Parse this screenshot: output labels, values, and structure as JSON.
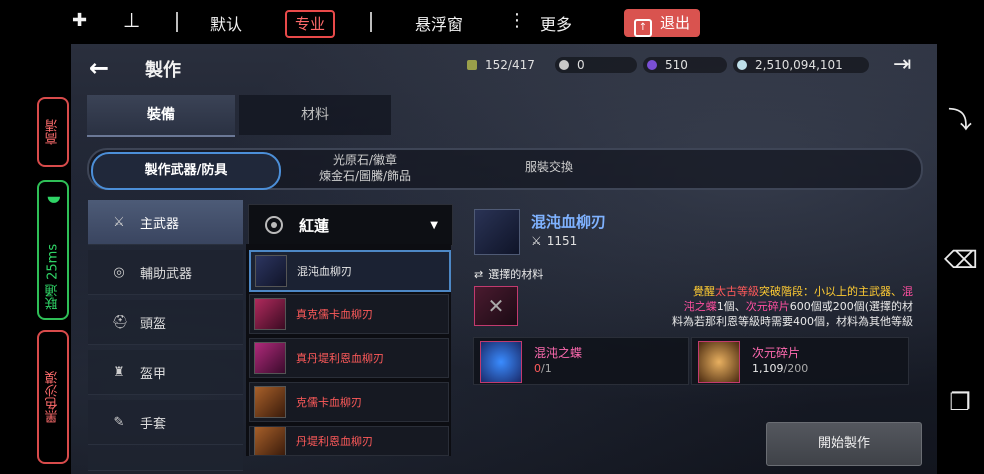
{
  "topbar": {
    "btn1_icon": "joystick-icon",
    "btn2_icon": "joystick-alt-icon",
    "default_label": "默认",
    "pro_label": "专业",
    "keyboard_label": "悬浮窗",
    "more_label": "更多",
    "exit_label": "退出",
    "accent": "#d9534f"
  },
  "side": {
    "hd_label": "高清",
    "network_label": "联通 25ms",
    "game_label": "黑色沙漠",
    "good_color": "#2fbf57"
  },
  "game": {
    "title": "製作",
    "resources": {
      "weight": "152/417",
      "silver": "0",
      "pearl": "510",
      "coin": "2,510,094,101"
    },
    "main_tabs": [
      "裝備",
      "材料"
    ],
    "sub_tabs": [
      "製作武器/防具",
      "光原石/徽章",
      "煉金石/圖騰/飾品",
      "服裝交換"
    ],
    "categories": [
      "主武器",
      "輔助武器",
      "頭盔",
      "盔甲",
      "手套"
    ],
    "dropdown_value": "紅蓮",
    "items": [
      {
        "name": "混沌血柳刃",
        "color": "#e8e8e8"
      },
      {
        "name": "真克儒卡血柳刃",
        "color": "#ff5a5a"
      },
      {
        "name": "真丹堤利恩血柳刃",
        "color": "#ff5a5a"
      },
      {
        "name": "克儒卡血柳刃",
        "color": "#ff5a5a"
      },
      {
        "name": "丹堤利恩血柳刃",
        "color": "#ff5a5a"
      }
    ],
    "detail": {
      "name": "混沌血柳刃",
      "count": "1151",
      "selected_materials_label": "選擇的材料",
      "desc_line1_prefix": "覺醒",
      "desc_line1_mid": "太古等級",
      "desc_line1_b": "突破階段",
      "desc_line1_c": "：小以上的主武器、",
      "desc_line1_d": "混",
      "desc_line2_a": "沌之蝶",
      "desc_line2_b": "1個、",
      "desc_line2_c": "次元碎片",
      "desc_line2_d": "600個或200個(選擇的材",
      "desc_line3": "料為若那利恩等級時需要400個，材料為其他等級",
      "materials": [
        {
          "name": "混沌之蝶",
          "have": "0",
          "need": "/1"
        },
        {
          "name": "次元碎片",
          "have": "1,109",
          "need": "/200"
        }
      ],
      "start_label": "開始製作"
    }
  }
}
